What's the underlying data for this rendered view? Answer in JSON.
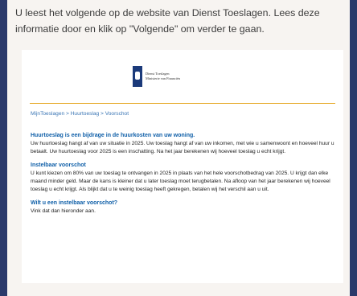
{
  "intro": "U leest het volgende op de website van Dienst Toeslagen. Lees deze informatie door en klik op \"Volgende\" om verder te gaan.",
  "logo": {
    "line1": "Dienst Toeslagen",
    "line2": "Ministerie van Financiën"
  },
  "breadcrumb": "MijnToeslagen > Huurtoeslag > Voorschot",
  "sections": [
    {
      "heading": "Huurtoeslag is een bijdrage in de huurkosten van uw woning.",
      "text": "Uw huurtoeslag hangt af van uw situatie in 2025. Uw toeslag hangt af van uw inkomen, met wie u samenwoont en hoeveel huur u betaalt. Uw huurtoeslag voor 2025 is een inschatting. Na het jaar berekenen wij hoeveel toeslag u echt krijgt."
    },
    {
      "heading": "Instelbaar voorschot",
      "text": "U kunt kiezen om 80% van uw toeslag te ontvangen in 2025 in plaats van het hele voorschotbedrag van 2025. U krijgt dan elke maand minder geld. Maar de kans is kleiner dat u later toeslag moet terugbetalen. Na afloop van het jaar berekenen wij hoeveel toeslag u echt krijgt. Als blijkt dat u te weinig toeslag heeft gekregen, betalen wij het verschil aan u uit."
    },
    {
      "heading": "Wilt u een instelbaar voorschot?",
      "text": "Vink dat dan hieronder aan."
    }
  ]
}
